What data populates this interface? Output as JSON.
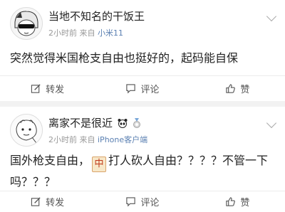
{
  "posts": [
    {
      "username": "当地不知名的干饭王",
      "time": "2小时前",
      "source_prefix": "来自",
      "device": "小米11",
      "text": "突然觉得米国枪支自由也挺好的，起码能自保",
      "actions": {
        "repost": "转发",
        "comment": "评论",
        "like": "赞"
      }
    },
    {
      "username": "离家不是很近",
      "time": "2小时前",
      "source_prefix": "来自",
      "device": "iPhone客户端",
      "text_before": "国外枪支自由，",
      "inline_icon_char": "中",
      "text_after": "打人砍人自由？？？？不管一下吗？？？",
      "actions": {
        "repost": "转发",
        "comment": "评论",
        "like": "赞"
      }
    }
  ],
  "colors": {
    "link": "#5b80b2",
    "meta": "#999999",
    "divider": "#ececec"
  },
  "icons": [
    "edit-icon",
    "comment-icon",
    "thumbs-up-icon",
    "chevron-down-icon",
    "panda-icon",
    "medal-icon"
  ]
}
